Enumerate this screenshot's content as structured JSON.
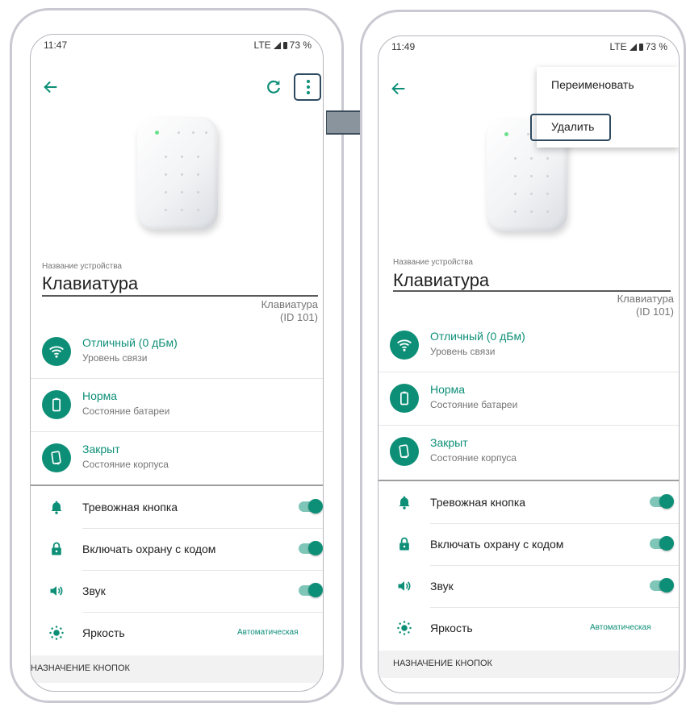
{
  "left": {
    "status": {
      "time": "11:47",
      "network": "LTE",
      "battery": "73 %"
    },
    "device": {
      "name_label": "Название устройства",
      "name": "Клавиатура",
      "model_line1": "Клавиатура",
      "model_line2": "(ID 101)"
    },
    "info_rows": [
      {
        "title": "Отличный (0 дБм)",
        "subtitle": "Уровень связи",
        "icon": "wifi-icon"
      },
      {
        "title": "Норма",
        "subtitle": "Состояние батареи",
        "icon": "battery-icon"
      },
      {
        "title": "Закрыт",
        "subtitle": "Состояние корпуса",
        "icon": "case-icon"
      }
    ],
    "settings": [
      {
        "label": "Тревожная кнопка",
        "icon": "bell-icon",
        "enabled": true
      },
      {
        "label": "Включать охрану с кодом",
        "icon": "lock-icon",
        "enabled": true
      },
      {
        "label": "Звук",
        "icon": "speaker-icon",
        "enabled": true
      },
      {
        "label": "Яркость",
        "icon": "brightness-icon",
        "value": "Автоматическая"
      }
    ],
    "section_header": "НАЗНАЧЕНИЕ КНОПОК"
  },
  "right": {
    "status": {
      "time": "11:49",
      "network": "LTE",
      "battery": "73 %"
    },
    "menu": {
      "rename": "Переименовать",
      "delete": "Удалить"
    },
    "device": {
      "name_label": "Название устройства",
      "name": "Клавиатура",
      "model_line1": "Клавиатура",
      "model_line2": "(ID 101)"
    },
    "info_rows": [
      {
        "title": "Отличный (0 дБм)",
        "subtitle": "Уровень связи",
        "icon": "wifi-icon"
      },
      {
        "title": "Норма",
        "subtitle": "Состояние батареи",
        "icon": "battery-icon"
      },
      {
        "title": "Закрыт",
        "subtitle": "Состояние корпуса",
        "icon": "case-icon"
      }
    ],
    "settings": [
      {
        "label": "Тревожная кнопка",
        "icon": "bell-icon",
        "enabled": true
      },
      {
        "label": "Включать охрану с кодом",
        "icon": "lock-icon",
        "enabled": true
      },
      {
        "label": "Звук",
        "icon": "speaker-icon",
        "enabled": true
      },
      {
        "label": "Яркость",
        "icon": "brightness-icon",
        "value": "Автоматическая"
      }
    ],
    "section_header": "НАЗНАЧЕНИЕ КНОПОК"
  },
  "colors": {
    "accent": "#0d8f77",
    "highlight_border": "#2e4a61",
    "arrow": "#8a949c"
  }
}
